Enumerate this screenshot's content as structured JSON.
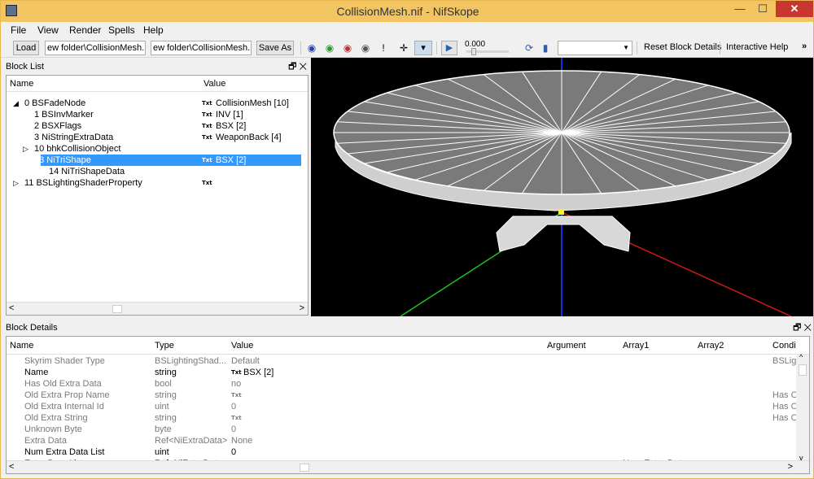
{
  "window": {
    "title": "CollisionMesh.nif - NifSkope"
  },
  "menus": [
    "File",
    "View",
    "Render",
    "Spells",
    "Help"
  ],
  "toolbar": {
    "load_label": "Load",
    "load_path": "ew folder\\CollisionMesh.nif",
    "save_path": "ew folder\\CollisionMesh.nif",
    "save_as_label": "Save As",
    "time_value": "0.000",
    "reset_label": "Reset Block Details",
    "help_label": "Interactive Help",
    "overflow": "»"
  },
  "block_list": {
    "title": "Block List",
    "col_name": "Name",
    "col_value": "Value",
    "rows": [
      {
        "arrow": "◢",
        "name": "0 BSFadeNode",
        "txt": "Txt",
        "value": "CollisionMesh [10]",
        "indent": 0
      },
      {
        "arrow": "",
        "name": "1 BSInvMarker",
        "txt": "Txt",
        "value": "INV [1]",
        "indent": 1
      },
      {
        "arrow": "",
        "name": "2 BSXFlags",
        "txt": "Txt",
        "value": "BSX [2]",
        "indent": 1
      },
      {
        "arrow": "",
        "name": "3 NiStringExtraData",
        "txt": "Txt",
        "value": "WeaponBack [4]",
        "indent": 1
      },
      {
        "arrow": "▷",
        "name": "10 bhkCollisionObject",
        "txt": "",
        "value": "",
        "indent": 1
      },
      {
        "arrow": "◢",
        "name": "13 NiTriShape",
        "txt": "Txt",
        "value": "BSX [2]",
        "indent": 1,
        "selected": true
      },
      {
        "arrow": "",
        "name": "14 NiTriShapeData",
        "txt": "",
        "value": "",
        "indent": 2
      },
      {
        "arrow": "▷",
        "name": "11 BSLightingShaderProperty",
        "txt": "Txt",
        "value": "",
        "indent": 0
      }
    ]
  },
  "block_details": {
    "title": "Block Details",
    "cols": {
      "name": "Name",
      "type": "Type",
      "value": "Value",
      "argument": "Argument",
      "array1": "Array1",
      "array2": "Array2",
      "cond": "Condi"
    },
    "rows": [
      {
        "name": "Skyrim Shader Type",
        "type": "BSLightingShad...",
        "txt": "",
        "value": "Default",
        "array1": "",
        "cond": "BSLigh",
        "grey": true
      },
      {
        "name": "Name",
        "type": "string",
        "txt": "Txt",
        "value": "BSX [2]",
        "array1": "",
        "cond": "",
        "grey": false
      },
      {
        "name": "Has Old Extra Data",
        "type": "bool",
        "txt": "",
        "value": "no",
        "array1": "",
        "cond": "",
        "grey": true
      },
      {
        "name": "Old Extra Prop Name",
        "type": "string",
        "txt": "Txt",
        "value": "",
        "array1": "",
        "cond": "Has O",
        "grey": true
      },
      {
        "name": "Old Extra Internal Id",
        "type": "uint",
        "txt": "",
        "value": "0",
        "array1": "",
        "cond": "Has O",
        "grey": true
      },
      {
        "name": "Old Extra String",
        "type": "string",
        "txt": "Txt",
        "value": "",
        "array1": "",
        "cond": "Has O",
        "grey": true
      },
      {
        "name": "Unknown Byte",
        "type": "byte",
        "txt": "",
        "value": "0",
        "array1": "",
        "cond": "",
        "grey": true
      },
      {
        "name": "Extra Data",
        "type": "Ref<NiExtraData>",
        "txt": "",
        "value": "None",
        "array1": "",
        "cond": "",
        "grey": true
      },
      {
        "name": "Num Extra Data List",
        "type": "uint",
        "txt": "",
        "value": "0",
        "array1": "",
        "cond": "",
        "grey": false
      },
      {
        "name": "Extra Data List",
        "type": "Ref<NiExtraData>",
        "txt": "",
        "value": "",
        "array1": "Num Extra Data",
        "cond": "",
        "grey": false
      }
    ]
  }
}
